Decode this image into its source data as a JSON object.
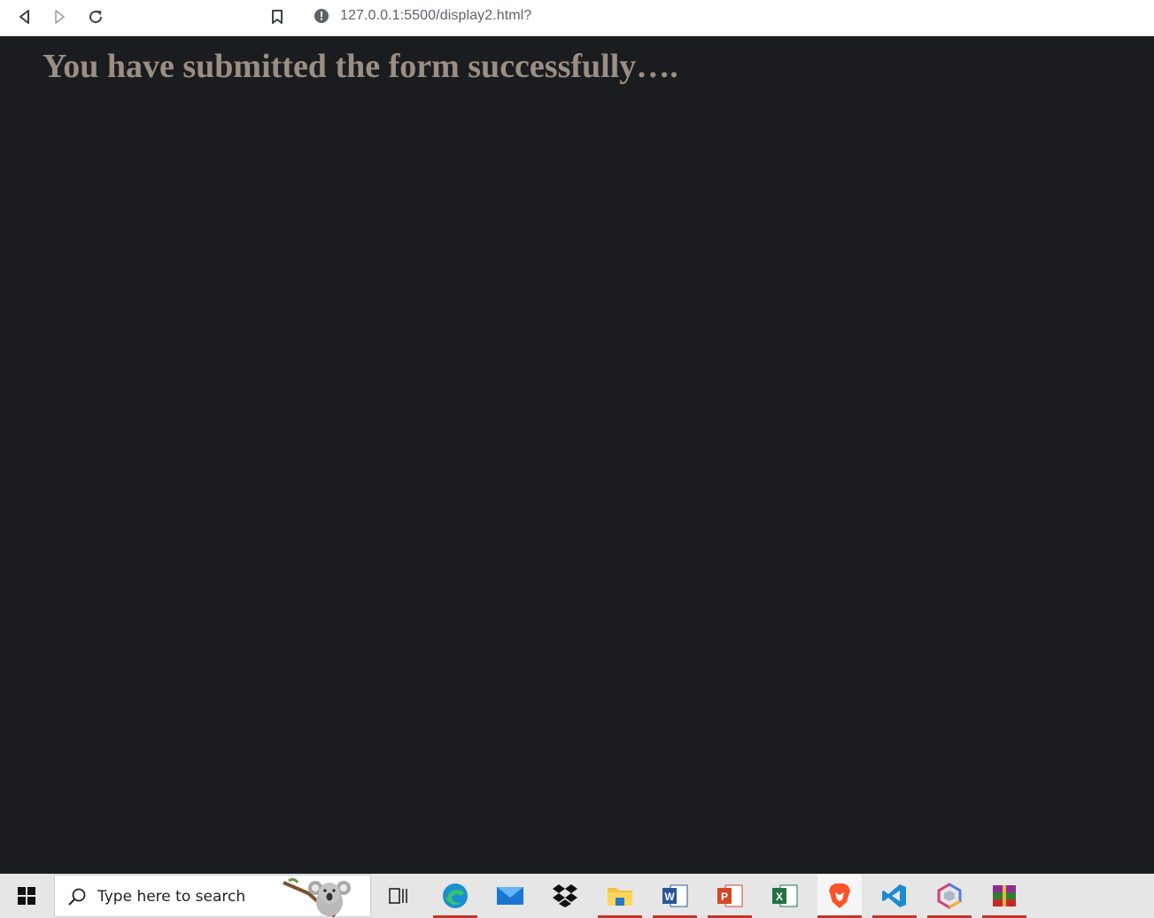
{
  "browser": {
    "url": "127.0.0.1:5500/display2.html?"
  },
  "page": {
    "headline": "You have submitted the form successfully…."
  },
  "taskbar": {
    "search_placeholder": "Type here to search",
    "apps": [
      {
        "name": "task-view-icon",
        "running": false
      },
      {
        "name": "edge-icon",
        "running": true
      },
      {
        "name": "mail-icon",
        "running": false
      },
      {
        "name": "dropbox-icon",
        "running": false
      },
      {
        "name": "file-explorer-icon",
        "running": true
      },
      {
        "name": "word-icon",
        "running": true
      },
      {
        "name": "powerpoint-icon",
        "running": true
      },
      {
        "name": "excel-icon",
        "running": false
      },
      {
        "name": "brave-icon",
        "running": true
      },
      {
        "name": "vscode-icon",
        "running": true
      },
      {
        "name": "app-cube-icon",
        "running": true
      },
      {
        "name": "winrar-icon",
        "running": true
      }
    ]
  },
  "colors": {
    "page_background": "#1b1c1f",
    "headline": "#9b8f83",
    "taskbar": "#e6e6e6",
    "running_indicator": "#c0392b"
  }
}
